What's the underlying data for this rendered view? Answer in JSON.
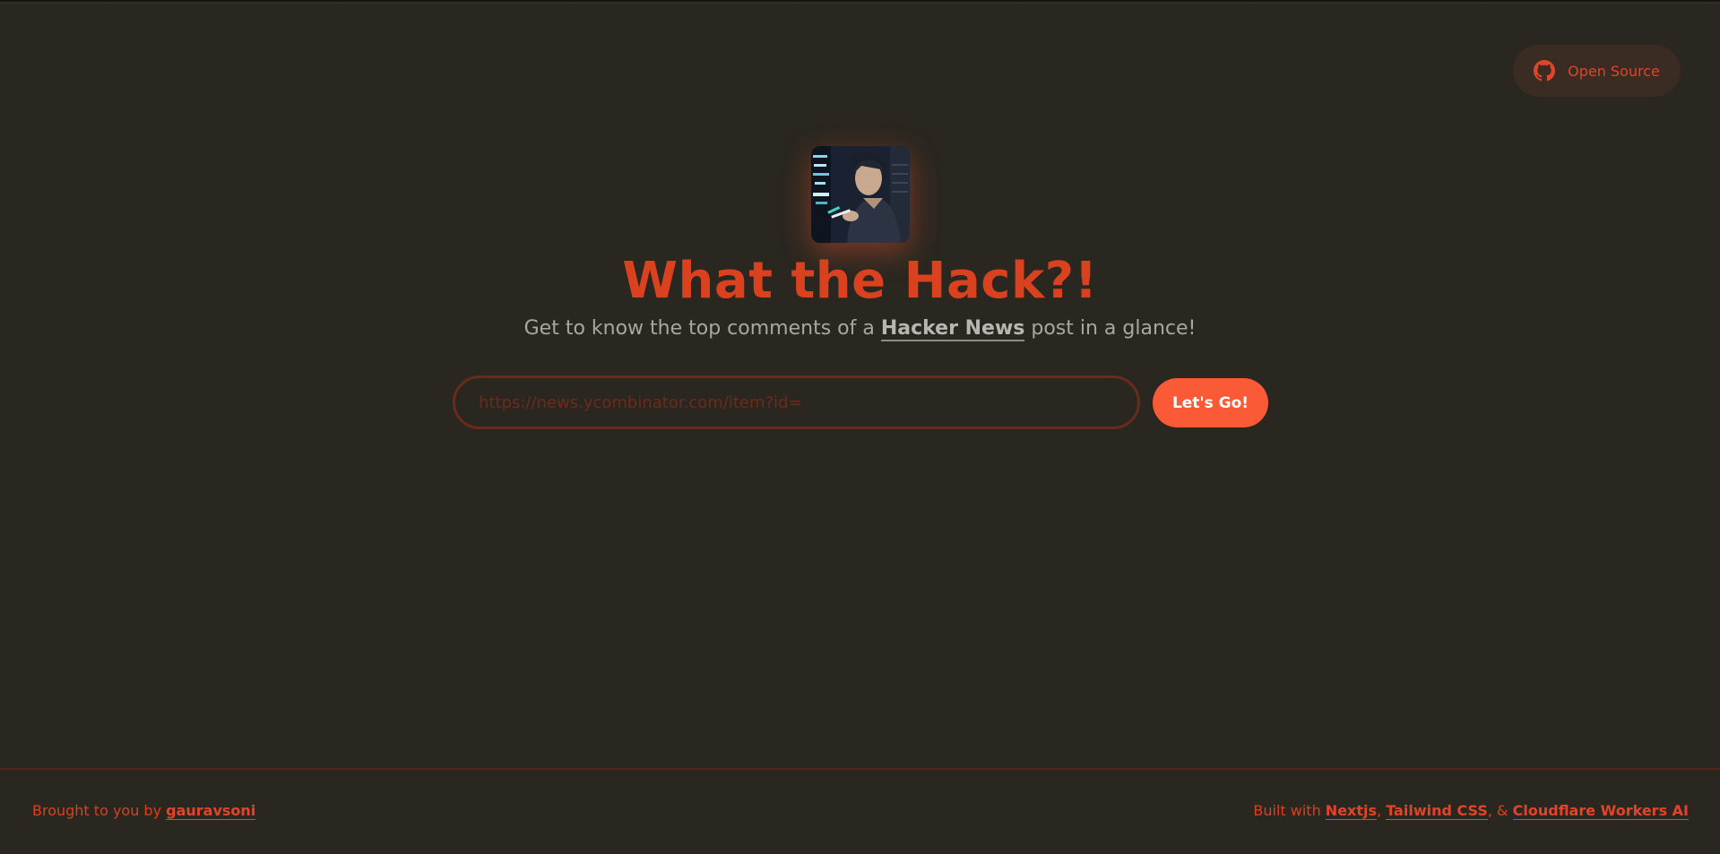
{
  "header": {
    "github_label": "Open Source",
    "github_icon": "github-icon"
  },
  "hero": {
    "avatar_alt": "hacker-avatar",
    "title": "What the Hack?!",
    "subtitle_before": "Get to know the top comments of a",
    "subtitle_link": "Hacker News",
    "subtitle_after": "post in a glance!"
  },
  "form": {
    "url_value": "",
    "url_placeholder": "https://news.ycombinator.com/item?id=",
    "submit_label": "Let's Go!"
  },
  "footer": {
    "left_text": "Brought to you by",
    "author_link": "gauravsoni",
    "right_text": "Built with",
    "tech_links": [
      "Nextjs",
      "Tailwind CSS",
      "Cloudflare Workers AI"
    ],
    "sep_comma": ",",
    "sep_amp": ", &"
  },
  "colors": {
    "background": "#2a2720",
    "accent": "#d9411f",
    "button": "#fa5a36"
  }
}
